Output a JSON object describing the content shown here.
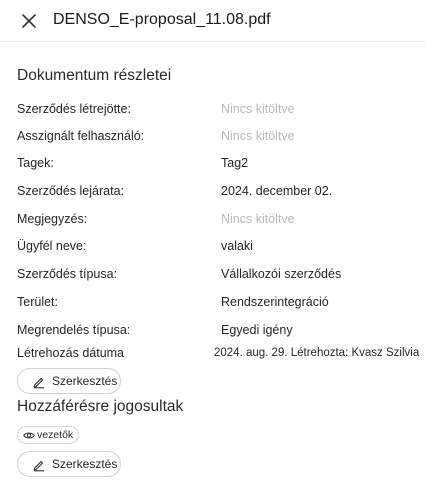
{
  "header": {
    "title": "DENSO_E-proposal_11.08.pdf",
    "close_icon": "close-icon"
  },
  "details": {
    "title": "Dokumentum részletei",
    "rows": [
      {
        "label": "Szerződés létrejötte:",
        "value": "Nincs kitöltve",
        "empty": true
      },
      {
        "label": "Asszignált felhasználó:",
        "value": "Nincs kitöltve",
        "empty": true
      },
      {
        "label": "Tagek:",
        "value": "Tag2",
        "empty": false
      },
      {
        "label": "Szerződés lejárata:",
        "value": "2024. december 02.",
        "empty": false
      },
      {
        "label": "Megjegyzés:",
        "value": "Nincs kitöltve",
        "empty": true
      },
      {
        "label": "Ügyfél neve:",
        "value": "valaki",
        "empty": false
      },
      {
        "label": "Szerződés típusa:",
        "value": "Vállalkozói szerződés",
        "empty": false
      },
      {
        "label": "Terület:",
        "value": "Rendszerintegráció",
        "empty": false
      },
      {
        "label": "Megrendelés típusa:",
        "value": "Egyedi igény",
        "empty": false
      },
      {
        "label": "Létrehozás dátuma",
        "value": "2024. aug. 29. Létrehozta: Kvasz Szilvia",
        "empty": false
      }
    ],
    "edit_label": "Szerkesztés"
  },
  "access": {
    "title": "Hozzáférésre jogosultak",
    "role_chip": "vezetők",
    "edit_label": "Szerkesztés"
  },
  "colors": {
    "text": "#262626",
    "placeholder": "#b9b9b9",
    "border": "#d3d3d3"
  }
}
